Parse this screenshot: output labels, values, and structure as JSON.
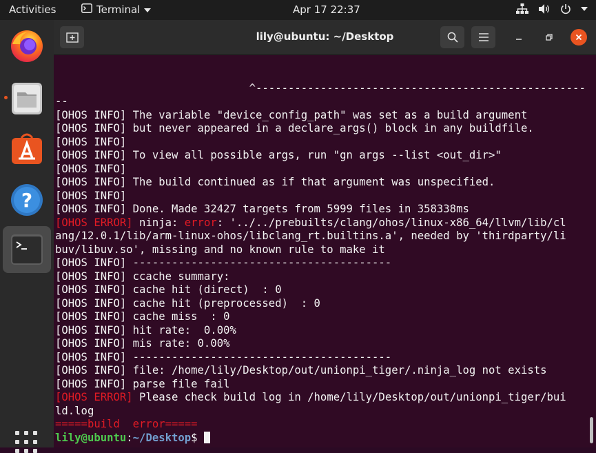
{
  "topbar": {
    "activities": "Activities",
    "app_name": "Terminal",
    "clock": "Apr 17  22:37"
  },
  "dock": {
    "items": [
      {
        "name": "firefox-icon"
      },
      {
        "name": "files-icon"
      },
      {
        "name": "software-icon"
      },
      {
        "name": "help-icon"
      },
      {
        "name": "terminal-icon"
      }
    ],
    "accent": "#e95420"
  },
  "window": {
    "title": "lily@ubuntu: ~/Desktop",
    "terminal_bg": "#300a24"
  },
  "terminal": {
    "lines": [
      "                              ^---------------------------------------------------",
      "--",
      "[OHOS INFO] The variable \"device_config_path\" was set as a build argument",
      "[OHOS INFO] but never appeared in a declare_args() block in any buildfile.",
      "[OHOS INFO]",
      "[OHOS INFO] To view all possible args, run \"gn args --list <out_dir>\"",
      "[OHOS INFO]",
      "[OHOS INFO] The build continued as if that argument was unspecified.",
      "[OHOS INFO]",
      "[OHOS INFO] Done. Made 32427 targets from 5999 files in 358338ms",
      {
        "err_tag": "[OHOS ERROR]",
        "mid": " ninja: ",
        "err_word": "error",
        "rest": ": '../../prebuilts/clang/ohos/linux-x86_64/llvm/lib/cl"
      },
      "ang/12.0.1/lib/arm-linux-ohos/libclang_rt.builtins.a', needed by 'thirdparty/li",
      "buv/libuv.so', missing and no known rule to make it",
      "[OHOS INFO] ----------------------------------------",
      "[OHOS INFO] ccache summary:",
      "[OHOS INFO] cache hit (direct)  : 0",
      "[OHOS INFO] cache hit (preprocessed)  : 0",
      "[OHOS INFO] cache miss  : 0",
      "[OHOS INFO] hit rate:  0.00%",
      "[OHOS INFO] mis rate: 0.00%",
      "[OHOS INFO] ----------------------------------------",
      "[OHOS INFO] file: /home/lily/Desktop/out/unionpi_tiger/.ninja_log not exists",
      "[OHOS INFO] parse file fail",
      {
        "err_tag": "[OHOS ERROR]",
        "mid": " Please check build log in /home/lily/Desktop/out/unionpi_tiger/bui",
        "err_word": "",
        "rest": ""
      },
      "ld.log",
      {
        "red_line": "=====build  error====="
      }
    ],
    "prompt_user": "lily@ubuntu",
    "prompt_path": "~/Desktop",
    "prompt_symbol": "$ "
  }
}
